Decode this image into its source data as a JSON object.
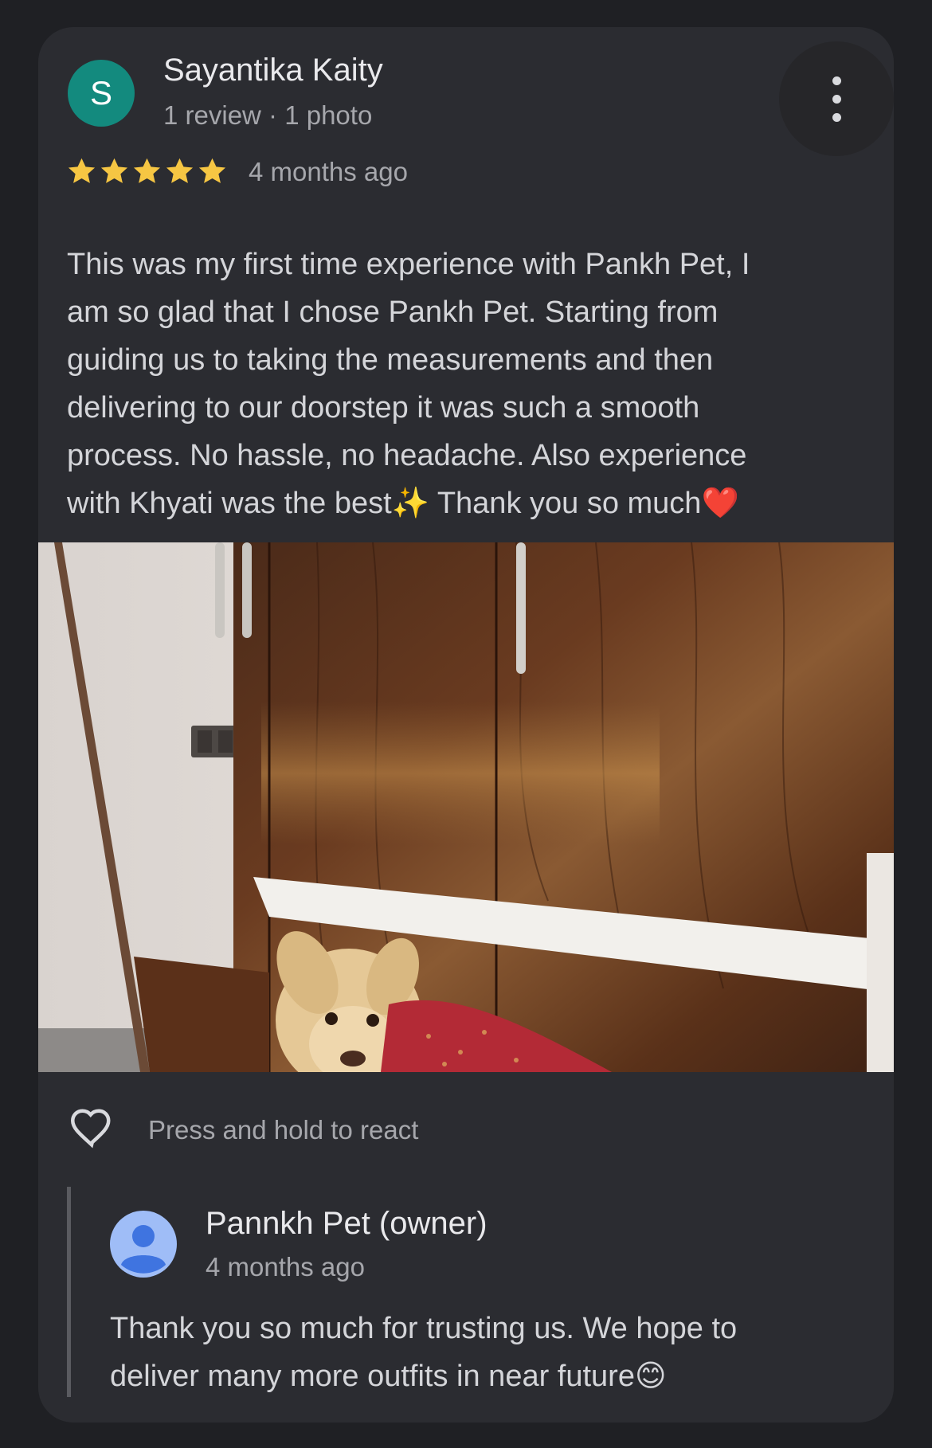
{
  "review": {
    "avatar_letter": "S",
    "author_name": "Sayantika Kaity",
    "author_meta": "1 review · 1 photo",
    "rating": 5,
    "posted": "4 months ago",
    "text": "This was my first time experience with Pankh Pet, I\nam so glad that I chose Pankh Pet. Starting from\nguiding us to taking the measurements and then\ndelivering to our doorstep it was such a smooth\nprocess. No hassle, no headache. Also experience\nwith Khyati was the best✨ Thank you so much❤️"
  },
  "reactions": {
    "label": "Press and hold to react"
  },
  "owner_reply": {
    "name": "Pannkh Pet (owner)",
    "posted": "4 months ago",
    "text": "Thank you so much for trusting us. We hope to\ndeliver many more outfits in near future😊"
  },
  "colors": {
    "page_bg": "#1f2024",
    "card_bg": "#2b2c31",
    "avatar_bg": "#138a7e",
    "star": "#f6c643",
    "owner_avatar_bg": "#9fbdf7",
    "owner_avatar_fg": "#3f74e0"
  }
}
